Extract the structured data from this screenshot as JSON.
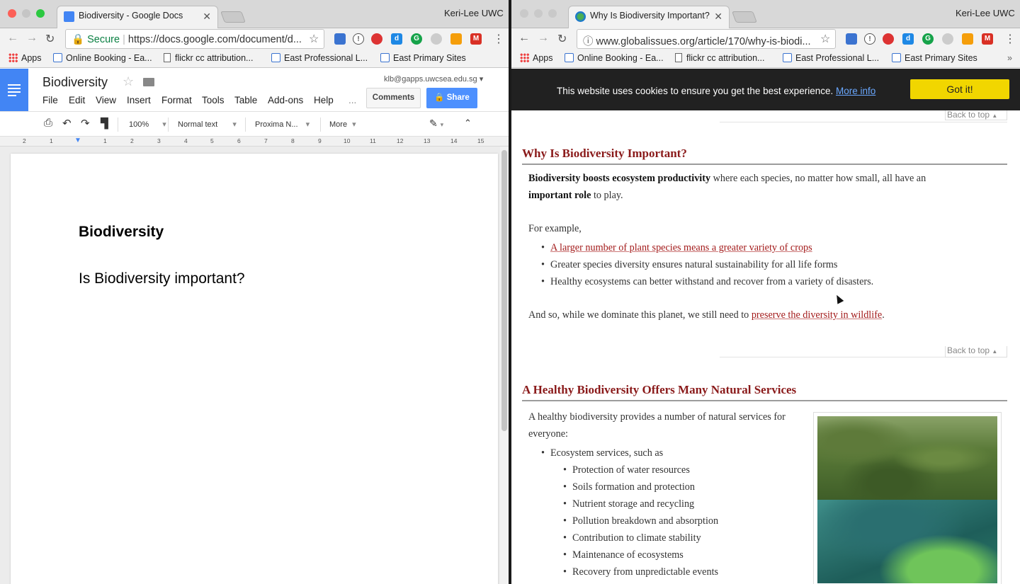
{
  "left": {
    "tab_title": "Biodiversity - Google Docs",
    "profile": "Keri-Lee UWC",
    "url_secure": "Secure",
    "url": "https://docs.google.com/document/d...",
    "bookmarks": [
      "Apps",
      "Online Booking - Ea...",
      "flickr cc attribution...",
      "East Professional L...",
      "East Primary Sites"
    ],
    "doc_title": "Biodiversity",
    "email": "klb@gapps.uwcsea.edu.sg",
    "menu": [
      "File",
      "Edit",
      "View",
      "Insert",
      "Format",
      "Tools",
      "Table",
      "Add-ons",
      "Help",
      "..."
    ],
    "comments_label": "Comments",
    "share_label": "Share",
    "zoom": "100%",
    "style": "Normal text",
    "font": "Proxima N...",
    "more": "More",
    "ruler": [
      "2",
      "1",
      "1",
      "1",
      "2",
      "3",
      "4",
      "5",
      "6",
      "7",
      "8",
      "9",
      "10",
      "11",
      "12",
      "13",
      "14",
      "15"
    ],
    "heading": "Biodiversity",
    "body": "Is Biodiversity important?"
  },
  "right": {
    "tab_title": "Why Is Biodiversity Important?",
    "profile": "Keri-Lee UWC",
    "url": "www.globalissues.org/article/170/why-is-biodi...",
    "bookmarks": [
      "Apps",
      "Online Booking - Ea...",
      "flickr cc attribution...",
      "East Professional L...",
      "East Primary Sites"
    ],
    "cookie_msg": "This website uses cookies to ensure you get the best experience.",
    "cookie_more": "More info",
    "cookie_btn": "Got it!",
    "back_to_top": "Back to top",
    "section1": {
      "heading": "Why Is Biodiversity Important?",
      "p1_bold1": "Biodiversity boosts ecosystem productivity",
      "p1_rest1": " where each species, no matter how small, all have an",
      "p1_bold2": "important role",
      "p1_rest2": " to play.",
      "for_example": "For example,",
      "bullets": [
        "A larger number of plant species means a greater variety of crops",
        "Greater species diversity ensures natural sustainability for all life forms",
        "Healthy ecosystems can better withstand and recover from a variety of disasters."
      ],
      "closing_pre": "And so, while we dominate this planet, we still need to ",
      "closing_link": "preserve the diversity in wildlife",
      "closing_post": "."
    },
    "section2": {
      "heading": "A Healthy Biodiversity Offers Many Natural Services",
      "intro_line1": "A healthy biodiversity provides a number of natural services for",
      "intro_line2": "everyone:",
      "bullet": "Ecosystem services, such as",
      "sub_bullets": [
        "Protection of water resources",
        "Soils formation and protection",
        "Nutrient storage and recycling",
        "Pollution breakdown and absorption",
        "Contribution to climate stability",
        "Maintenance of ecosystems",
        "Recovery from unpredictable events"
      ]
    }
  }
}
